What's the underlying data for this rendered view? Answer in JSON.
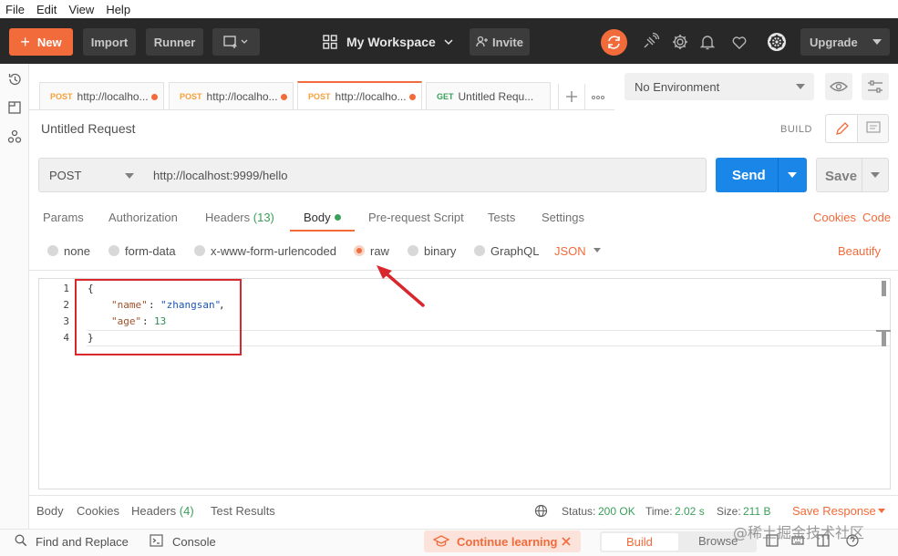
{
  "menu": [
    "File",
    "Edit",
    "View",
    "Help"
  ],
  "header": {
    "new_label": "New",
    "import_label": "Import",
    "runner_label": "Runner",
    "workspace_label": "My Workspace",
    "invite_label": "Invite",
    "upgrade_label": "Upgrade"
  },
  "tabs": [
    {
      "method": "POST",
      "label": "http://localho...",
      "unsaved": true
    },
    {
      "method": "POST",
      "label": "http://localho...",
      "unsaved": true
    },
    {
      "method": "POST",
      "label": "http://localho...",
      "unsaved": true,
      "active": true
    },
    {
      "method": "GET",
      "label": "Untitled Requ...",
      "unsaved": false
    }
  ],
  "environment": {
    "selected": "No Environment"
  },
  "request": {
    "title": "Untitled Request",
    "build_label": "BUILD",
    "method": "POST",
    "url": "http://localhost:9999/hello",
    "send_label": "Send",
    "save_label": "Save"
  },
  "request_tabs": {
    "params": "Params",
    "authorization": "Authorization",
    "headers": "Headers",
    "headers_count": "(13)",
    "body": "Body",
    "prerequest": "Pre-request Script",
    "tests": "Tests",
    "settings": "Settings",
    "cookies": "Cookies",
    "code": "Code"
  },
  "body_types": {
    "none": "none",
    "form_data": "form-data",
    "urlencoded": "x-www-form-urlencoded",
    "raw": "raw",
    "binary": "binary",
    "graphql": "GraphQL",
    "format": "JSON",
    "beautify": "Beautify",
    "selected": "raw"
  },
  "editor": {
    "line_numbers": [
      "1",
      "2",
      "3",
      "4"
    ],
    "open_brace": "{",
    "key1": "\"name\"",
    "val1": "\"zhangsan\"",
    "key2": "\"age\"",
    "val2": "13",
    "close_brace": "}"
  },
  "response": {
    "body": "Body",
    "cookies": "Cookies",
    "headers": "Headers",
    "headers_count": "(4)",
    "test_results": "Test Results",
    "status_label": "Status:",
    "status_value": "200 OK",
    "time_label": "Time:",
    "time_value": "2.02 s",
    "size_label": "Size:",
    "size_value": "211 B",
    "save_response": "Save Response"
  },
  "footer": {
    "find_replace": "Find and Replace",
    "console": "Console",
    "continue_learning": "Continue learning",
    "build": "Build",
    "browse": "Browse"
  },
  "watermark": "@稀土掘金技术社区",
  "colors": {
    "accent": "#f26b3a",
    "send": "#1a86e8",
    "header_bg": "#282828",
    "highlight_box": "#d9272e"
  }
}
